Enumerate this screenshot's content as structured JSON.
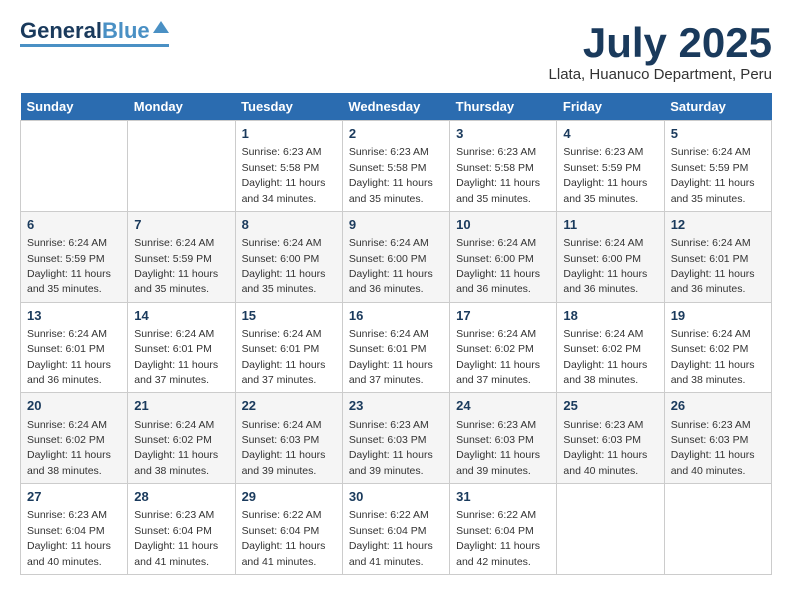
{
  "header": {
    "logo_general": "General",
    "logo_blue": "Blue",
    "month_title": "July 2025",
    "location": "Llata, Huanuco Department, Peru"
  },
  "days_of_week": [
    "Sunday",
    "Monday",
    "Tuesday",
    "Wednesday",
    "Thursday",
    "Friday",
    "Saturday"
  ],
  "weeks": [
    [
      {
        "day": "",
        "sunrise": "",
        "sunset": "",
        "daylight": ""
      },
      {
        "day": "",
        "sunrise": "",
        "sunset": "",
        "daylight": ""
      },
      {
        "day": "1",
        "sunrise": "Sunrise: 6:23 AM",
        "sunset": "Sunset: 5:58 PM",
        "daylight": "Daylight: 11 hours and 34 minutes."
      },
      {
        "day": "2",
        "sunrise": "Sunrise: 6:23 AM",
        "sunset": "Sunset: 5:58 PM",
        "daylight": "Daylight: 11 hours and 35 minutes."
      },
      {
        "day": "3",
        "sunrise": "Sunrise: 6:23 AM",
        "sunset": "Sunset: 5:58 PM",
        "daylight": "Daylight: 11 hours and 35 minutes."
      },
      {
        "day": "4",
        "sunrise": "Sunrise: 6:23 AM",
        "sunset": "Sunset: 5:59 PM",
        "daylight": "Daylight: 11 hours and 35 minutes."
      },
      {
        "day": "5",
        "sunrise": "Sunrise: 6:24 AM",
        "sunset": "Sunset: 5:59 PM",
        "daylight": "Daylight: 11 hours and 35 minutes."
      }
    ],
    [
      {
        "day": "6",
        "sunrise": "Sunrise: 6:24 AM",
        "sunset": "Sunset: 5:59 PM",
        "daylight": "Daylight: 11 hours and 35 minutes."
      },
      {
        "day": "7",
        "sunrise": "Sunrise: 6:24 AM",
        "sunset": "Sunset: 5:59 PM",
        "daylight": "Daylight: 11 hours and 35 minutes."
      },
      {
        "day": "8",
        "sunrise": "Sunrise: 6:24 AM",
        "sunset": "Sunset: 6:00 PM",
        "daylight": "Daylight: 11 hours and 35 minutes."
      },
      {
        "day": "9",
        "sunrise": "Sunrise: 6:24 AM",
        "sunset": "Sunset: 6:00 PM",
        "daylight": "Daylight: 11 hours and 36 minutes."
      },
      {
        "day": "10",
        "sunrise": "Sunrise: 6:24 AM",
        "sunset": "Sunset: 6:00 PM",
        "daylight": "Daylight: 11 hours and 36 minutes."
      },
      {
        "day": "11",
        "sunrise": "Sunrise: 6:24 AM",
        "sunset": "Sunset: 6:00 PM",
        "daylight": "Daylight: 11 hours and 36 minutes."
      },
      {
        "day": "12",
        "sunrise": "Sunrise: 6:24 AM",
        "sunset": "Sunset: 6:01 PM",
        "daylight": "Daylight: 11 hours and 36 minutes."
      }
    ],
    [
      {
        "day": "13",
        "sunrise": "Sunrise: 6:24 AM",
        "sunset": "Sunset: 6:01 PM",
        "daylight": "Daylight: 11 hours and 36 minutes."
      },
      {
        "day": "14",
        "sunrise": "Sunrise: 6:24 AM",
        "sunset": "Sunset: 6:01 PM",
        "daylight": "Daylight: 11 hours and 37 minutes."
      },
      {
        "day": "15",
        "sunrise": "Sunrise: 6:24 AM",
        "sunset": "Sunset: 6:01 PM",
        "daylight": "Daylight: 11 hours and 37 minutes."
      },
      {
        "day": "16",
        "sunrise": "Sunrise: 6:24 AM",
        "sunset": "Sunset: 6:01 PM",
        "daylight": "Daylight: 11 hours and 37 minutes."
      },
      {
        "day": "17",
        "sunrise": "Sunrise: 6:24 AM",
        "sunset": "Sunset: 6:02 PM",
        "daylight": "Daylight: 11 hours and 37 minutes."
      },
      {
        "day": "18",
        "sunrise": "Sunrise: 6:24 AM",
        "sunset": "Sunset: 6:02 PM",
        "daylight": "Daylight: 11 hours and 38 minutes."
      },
      {
        "day": "19",
        "sunrise": "Sunrise: 6:24 AM",
        "sunset": "Sunset: 6:02 PM",
        "daylight": "Daylight: 11 hours and 38 minutes."
      }
    ],
    [
      {
        "day": "20",
        "sunrise": "Sunrise: 6:24 AM",
        "sunset": "Sunset: 6:02 PM",
        "daylight": "Daylight: 11 hours and 38 minutes."
      },
      {
        "day": "21",
        "sunrise": "Sunrise: 6:24 AM",
        "sunset": "Sunset: 6:02 PM",
        "daylight": "Daylight: 11 hours and 38 minutes."
      },
      {
        "day": "22",
        "sunrise": "Sunrise: 6:24 AM",
        "sunset": "Sunset: 6:03 PM",
        "daylight": "Daylight: 11 hours and 39 minutes."
      },
      {
        "day": "23",
        "sunrise": "Sunrise: 6:23 AM",
        "sunset": "Sunset: 6:03 PM",
        "daylight": "Daylight: 11 hours and 39 minutes."
      },
      {
        "day": "24",
        "sunrise": "Sunrise: 6:23 AM",
        "sunset": "Sunset: 6:03 PM",
        "daylight": "Daylight: 11 hours and 39 minutes."
      },
      {
        "day": "25",
        "sunrise": "Sunrise: 6:23 AM",
        "sunset": "Sunset: 6:03 PM",
        "daylight": "Daylight: 11 hours and 40 minutes."
      },
      {
        "day": "26",
        "sunrise": "Sunrise: 6:23 AM",
        "sunset": "Sunset: 6:03 PM",
        "daylight": "Daylight: 11 hours and 40 minutes."
      }
    ],
    [
      {
        "day": "27",
        "sunrise": "Sunrise: 6:23 AM",
        "sunset": "Sunset: 6:04 PM",
        "daylight": "Daylight: 11 hours and 40 minutes."
      },
      {
        "day": "28",
        "sunrise": "Sunrise: 6:23 AM",
        "sunset": "Sunset: 6:04 PM",
        "daylight": "Daylight: 11 hours and 41 minutes."
      },
      {
        "day": "29",
        "sunrise": "Sunrise: 6:22 AM",
        "sunset": "Sunset: 6:04 PM",
        "daylight": "Daylight: 11 hours and 41 minutes."
      },
      {
        "day": "30",
        "sunrise": "Sunrise: 6:22 AM",
        "sunset": "Sunset: 6:04 PM",
        "daylight": "Daylight: 11 hours and 41 minutes."
      },
      {
        "day": "31",
        "sunrise": "Sunrise: 6:22 AM",
        "sunset": "Sunset: 6:04 PM",
        "daylight": "Daylight: 11 hours and 42 minutes."
      },
      {
        "day": "",
        "sunrise": "",
        "sunset": "",
        "daylight": ""
      },
      {
        "day": "",
        "sunrise": "",
        "sunset": "",
        "daylight": ""
      }
    ]
  ]
}
